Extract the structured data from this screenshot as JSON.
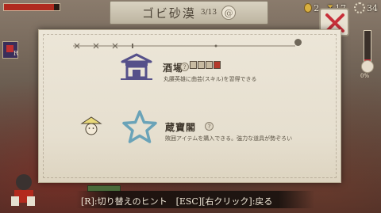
{
  "hud": {
    "hp_fraction": 0.9,
    "gold": "2",
    "energy": "17",
    "gear_count": "34"
  },
  "title": {
    "name": "ゴビ砂漠",
    "progress": "3/13"
  },
  "entries": [
    {
      "icon": "tavern-icon",
      "title": "酒場",
      "help": "?",
      "description": "丸腰英雄に曲芸(スキル)を習得できる"
    },
    {
      "icon": "star-icon",
      "title": "蔵寶閣",
      "help": "?",
      "description": "敗囲アイテムを購入できる。強力な道具が勢ぞろい"
    }
  ],
  "hint": "[R]:切り替えのヒント　[ESC][右クリック]:戻る",
  "gauge": {
    "label": "0%",
    "level": 0.1
  },
  "side": {
    "tag": "R"
  },
  "colors": {
    "accent_red": "#c8303a",
    "tavern_blue": "#55508a",
    "star_teal": "#6aa3b8"
  }
}
